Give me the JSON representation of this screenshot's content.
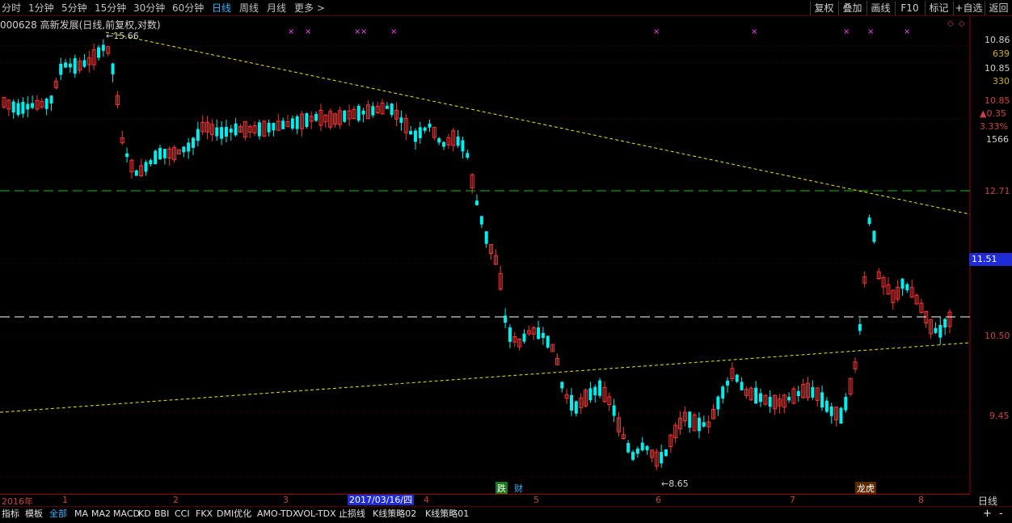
{
  "toolbar": {
    "tabs": [
      {
        "label": "分时",
        "active": false
      },
      {
        "label": "1分钟",
        "active": false
      },
      {
        "label": "5分钟",
        "active": false
      },
      {
        "label": "15分钟",
        "active": false
      },
      {
        "label": "30分钟",
        "active": false
      },
      {
        "label": "60分钟",
        "active": false
      },
      {
        "label": "日线",
        "active": true
      },
      {
        "label": "周线",
        "active": false
      },
      {
        "label": "月线",
        "active": false
      },
      {
        "label": "更多 >",
        "active": false
      }
    ],
    "right_buttons": [
      "复权",
      "叠加",
      "画线",
      "F10",
      "标记",
      "+自选",
      "返回"
    ]
  },
  "stock": {
    "title": "000628 高新发展(日线,前复权,对数)"
  },
  "price_axis": {
    "labels": [
      {
        "text": "10.86",
        "color": "#d0d0d0"
      },
      {
        "text": "639",
        "color": "#d0b000"
      },
      {
        "text": "10.85",
        "color": "#d0d0d0"
      },
      {
        "text": "330",
        "color": "#d0b000"
      },
      {
        "text": "10.85",
        "color": "#d04040"
      },
      {
        "text": "▲0.35",
        "color": "#d04040"
      },
      {
        "text": "3.33%",
        "color": "#d04040"
      },
      {
        "text": "1566",
        "color": "#d0d0d0"
      },
      {
        "text": "12.71",
        "color": "#d04040"
      },
      {
        "text": "11.51",
        "color": "#ffffff"
      },
      {
        "text": "10.50",
        "color": "#d04040"
      },
      {
        "text": "9.45",
        "color": "#d04040"
      }
    ]
  },
  "annotations": {
    "high_label": "15.66",
    "low_label": "8.65"
  },
  "events": [
    {
      "text": "跌",
      "bg": "#1a7a1a",
      "color": "#ffffff"
    },
    {
      "text": "财",
      "bg": "#000000",
      "color": "#26b6ff"
    },
    {
      "text": "龙虎",
      "bg": "#5a2a00",
      "color": "#ffffff"
    }
  ],
  "date_axis": {
    "months": [
      "2016年",
      "1",
      "2",
      "3",
      "4",
      "5",
      "6",
      "7",
      "8"
    ],
    "cursor_date": "2017/03/16/四",
    "period": "日线"
  },
  "indicator_bar": {
    "items": [
      {
        "label": "指标",
        "active": false
      },
      {
        "label": "模板",
        "active": false
      },
      {
        "label": "全部",
        "active": true
      },
      {
        "label": "MA",
        "active": false
      },
      {
        "label": "MA2",
        "active": false
      },
      {
        "label": "MACD",
        "active": false
      },
      {
        "label": "KD",
        "active": false
      },
      {
        "label": "BBI",
        "active": false
      },
      {
        "label": "CCI",
        "active": false
      },
      {
        "label": "FKX",
        "active": false
      },
      {
        "label": "DMI优化",
        "active": false
      },
      {
        "label": "AMO-TDX",
        "active": false
      },
      {
        "label": "VOL-TDX",
        "active": false
      },
      {
        "label": "止损线",
        "active": false
      },
      {
        "label": "K线策略02",
        "active": false
      },
      {
        "label": "K线策略01",
        "active": false
      }
    ],
    "zoom_in": "+",
    "zoom_out": "-"
  },
  "colors": {
    "up": "#ff3232",
    "down": "#00f0f0",
    "trend_line": "#e8e800",
    "support_green": "#00c800",
    "white_line": "#ffffff",
    "grid": "#5a0000"
  }
}
